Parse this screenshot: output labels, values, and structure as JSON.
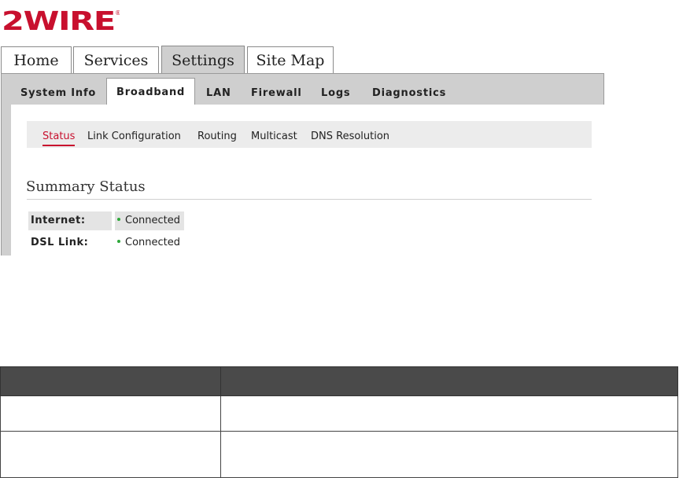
{
  "brand": {
    "logo_text": "2WIRE",
    "logo_color": "#c8102e"
  },
  "main_tabs": [
    {
      "label": "Home",
      "active": false
    },
    {
      "label": "Services",
      "active": false
    },
    {
      "label": "Settings",
      "active": true
    },
    {
      "label": "Site Map",
      "active": false
    }
  ],
  "sub_tabs": [
    {
      "label": "System Info",
      "active": false
    },
    {
      "label": "Broadband",
      "active": true
    },
    {
      "label": "LAN",
      "active": false
    },
    {
      "label": "Firewall",
      "active": false
    },
    {
      "label": "Logs",
      "active": false
    },
    {
      "label": "Diagnostics",
      "active": false
    }
  ],
  "sub_nav": [
    {
      "label": "Status",
      "active": true
    },
    {
      "label": "Link Configuration",
      "active": false
    },
    {
      "label": "Routing",
      "active": false
    },
    {
      "label": "Multicast",
      "active": false
    },
    {
      "label": "DNS Resolution",
      "active": false
    }
  ],
  "summary": {
    "title": "Summary Status",
    "rows": [
      {
        "label": "Internet:",
        "value": "Connected",
        "status_color": "#2ea83a"
      },
      {
        "label": "DSL Link:",
        "value": "Connected",
        "status_color": "#2ea83a"
      }
    ]
  },
  "lower_table": {
    "headers": [
      "",
      ""
    ],
    "rows": [
      [
        "",
        ""
      ],
      [
        "",
        ""
      ]
    ]
  }
}
